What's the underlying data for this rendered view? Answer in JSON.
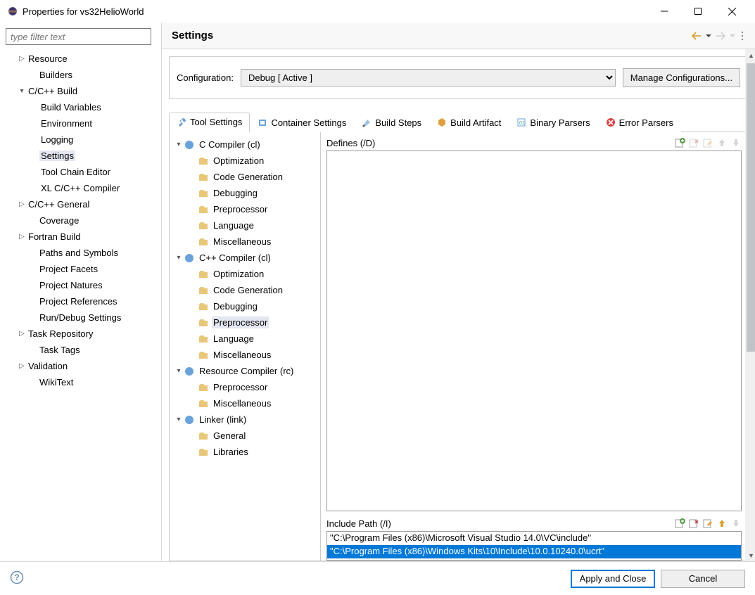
{
  "window": {
    "title": "Properties for vs32HelioWorld"
  },
  "filter": {
    "placeholder": "type filter text"
  },
  "nav": {
    "resource": "Resource",
    "builders": "Builders",
    "cppbuild": "C/C++ Build",
    "buildvars": "Build Variables",
    "environment": "Environment",
    "logging": "Logging",
    "settings": "Settings",
    "toolchain": "Tool Chain Editor",
    "xl": "XL C/C++ Compiler",
    "cppgeneral": "C/C++ General",
    "coverage": "Coverage",
    "fortran": "Fortran Build",
    "paths": "Paths and Symbols",
    "facets": "Project Facets",
    "natures": "Project Natures",
    "refs": "Project References",
    "rundebug": "Run/Debug Settings",
    "taskrepo": "Task Repository",
    "tasktags": "Task Tags",
    "validation": "Validation",
    "wikitext": "WikiText"
  },
  "header": {
    "title": "Settings"
  },
  "config": {
    "label": "Configuration:",
    "value": "Debug  [ Active ]",
    "manage": "Manage Configurations..."
  },
  "tabs": {
    "toolsettings": "Tool Settings",
    "container": "Container Settings",
    "buildsteps": "Build Steps",
    "buildartifact": "Build Artifact",
    "binary": "Binary Parsers",
    "errors": "Error Parsers"
  },
  "tooltree": {
    "ccompiler": "C Compiler (cl)",
    "optimization": "Optimization",
    "codegen": "Code Generation",
    "debugging": "Debugging",
    "preprocessor": "Preprocessor",
    "language": "Language",
    "misc": "Miscellaneous",
    "cppcompiler": "C++ Compiler (cl)",
    "rescompiler": "Resource Compiler (rc)",
    "linker": "Linker (link)",
    "general": "General",
    "libraries": "Libraries"
  },
  "defines": {
    "label": "Defines (/D)"
  },
  "include": {
    "label": "Include Path (/I)",
    "row0": "\"C:\\Program Files (x86)\\Microsoft Visual Studio 14.0\\VC\\include\"",
    "row1": "\"C:\\Program Files (x86)\\Windows Kits\\10\\Include\\10.0.10240.0\\ucrt\""
  },
  "footer": {
    "apply": "Apply and Close",
    "cancel": "Cancel"
  }
}
